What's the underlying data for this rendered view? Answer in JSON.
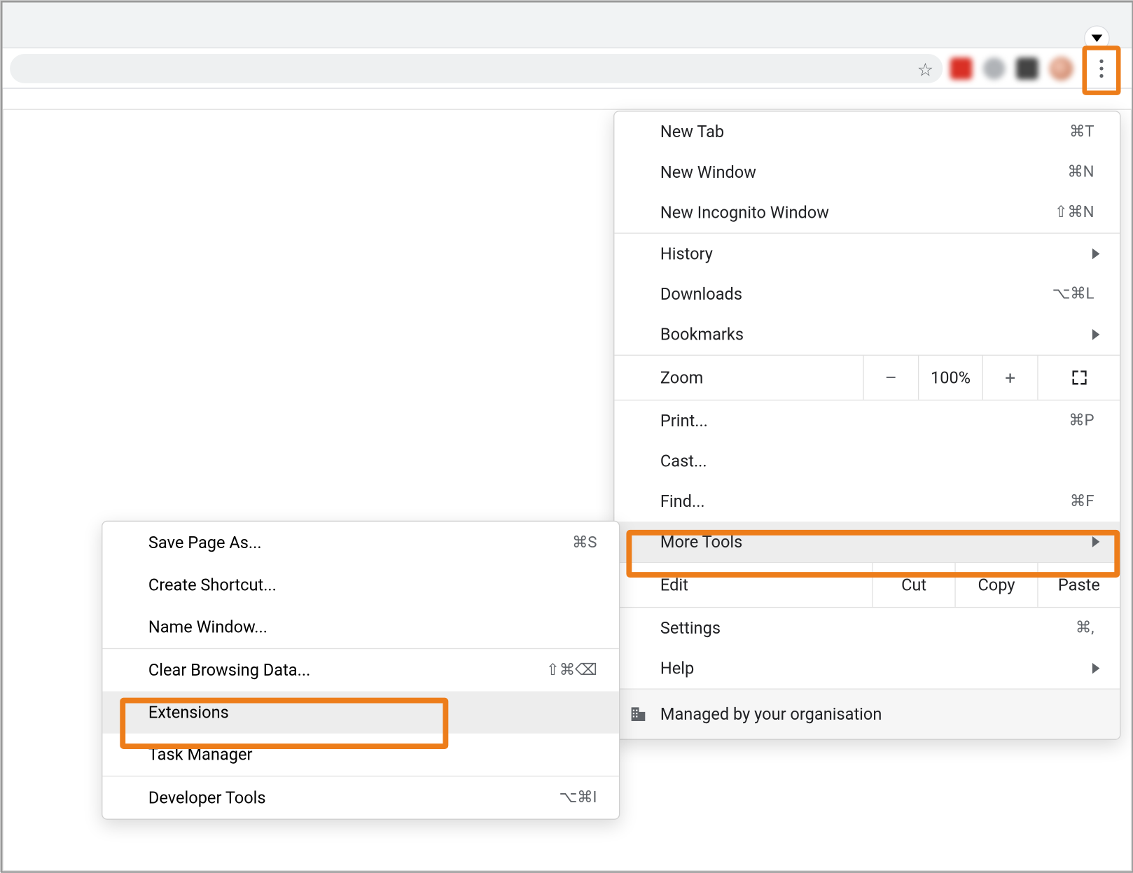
{
  "main_menu": {
    "items_group1": [
      {
        "label": "New Tab",
        "shortcut": "⌘T",
        "name": "menu-new-tab"
      },
      {
        "label": "New Window",
        "shortcut": "⌘N",
        "name": "menu-new-window"
      },
      {
        "label": "New Incognito Window",
        "shortcut": "⇧⌘N",
        "name": "menu-new-incognito"
      }
    ],
    "items_group2": [
      {
        "label": "History",
        "shortcut": "",
        "submenu": true,
        "name": "menu-history"
      },
      {
        "label": "Downloads",
        "shortcut": "⌥⌘L",
        "name": "menu-downloads"
      },
      {
        "label": "Bookmarks",
        "shortcut": "",
        "submenu": true,
        "name": "menu-bookmarks"
      }
    ],
    "zoom": {
      "label": "Zoom",
      "pct": "100%",
      "minus": "–",
      "plus": "+"
    },
    "items_group3": [
      {
        "label": "Print...",
        "shortcut": "⌘P",
        "name": "menu-print"
      },
      {
        "label": "Cast...",
        "shortcut": "",
        "name": "menu-cast"
      },
      {
        "label": "Find...",
        "shortcut": "⌘F",
        "name": "menu-find"
      },
      {
        "label": "More Tools",
        "shortcut": "",
        "submenu": true,
        "hovered": true,
        "name": "menu-more-tools"
      }
    ],
    "edit": {
      "label": "Edit",
      "cut": "Cut",
      "copy": "Copy",
      "paste": "Paste"
    },
    "items_group4": [
      {
        "label": "Settings",
        "shortcut": "⌘,",
        "name": "menu-settings"
      },
      {
        "label": "Help",
        "shortcut": "",
        "submenu": true,
        "name": "menu-help"
      }
    ],
    "managed_label": "Managed by your organisation"
  },
  "submenu": {
    "items_group1": [
      {
        "label": "Save Page As...",
        "shortcut": "⌘S",
        "name": "submenu-save-page"
      },
      {
        "label": "Create Shortcut...",
        "shortcut": "",
        "name": "submenu-create-shortcut"
      },
      {
        "label": "Name Window...",
        "shortcut": "",
        "name": "submenu-name-window"
      }
    ],
    "items_group2": [
      {
        "label": "Clear Browsing Data...",
        "shortcut": "⇧⌘⌫",
        "name": "submenu-clear-data"
      },
      {
        "label": "Extensions",
        "shortcut": "",
        "hovered": true,
        "name": "submenu-extensions"
      },
      {
        "label": "Task Manager",
        "shortcut": "",
        "name": "submenu-task-manager"
      }
    ],
    "items_group3": [
      {
        "label": "Developer Tools",
        "shortcut": "⌥⌘I",
        "name": "submenu-dev-tools"
      }
    ]
  }
}
